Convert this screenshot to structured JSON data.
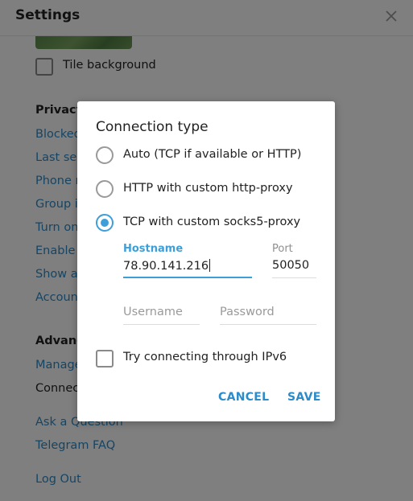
{
  "settings": {
    "title": "Settings",
    "tile_background_label": "Tile background",
    "privacy_title": "Privacy",
    "privacy_items": [
      "Blocked",
      "Last see",
      "Phone n",
      "Group in",
      "Turn on",
      "Enable t",
      "Show al",
      "Account"
    ],
    "advanced_title": "Advanc",
    "advanced_items": [
      "Manage",
      "Connect"
    ],
    "help_items": [
      "Ask a Question",
      "Telegram FAQ"
    ],
    "logout_label": "Log Out"
  },
  "dialog": {
    "title": "Connection type",
    "options": [
      {
        "label": "Auto (TCP if available or HTTP)",
        "selected": false
      },
      {
        "label": "HTTP with custom http-proxy",
        "selected": false
      },
      {
        "label": "TCP with custom socks5-proxy",
        "selected": true
      }
    ],
    "hostname_label": "Hostname",
    "hostname_value": "78.90.141.216",
    "port_label": "Port",
    "port_value": "50050",
    "username_placeholder": "Username",
    "password_placeholder": "Password",
    "ipv6_label": "Try connecting through IPv6",
    "ipv6_checked": false,
    "cancel_label": "CANCEL",
    "save_label": "SAVE"
  },
  "colors": {
    "accent": "#3e9fd8",
    "link": "#2d8bc9",
    "overlay": "rgba(0,0,0,0.5)"
  },
  "icons": {
    "close": "close-icon"
  }
}
